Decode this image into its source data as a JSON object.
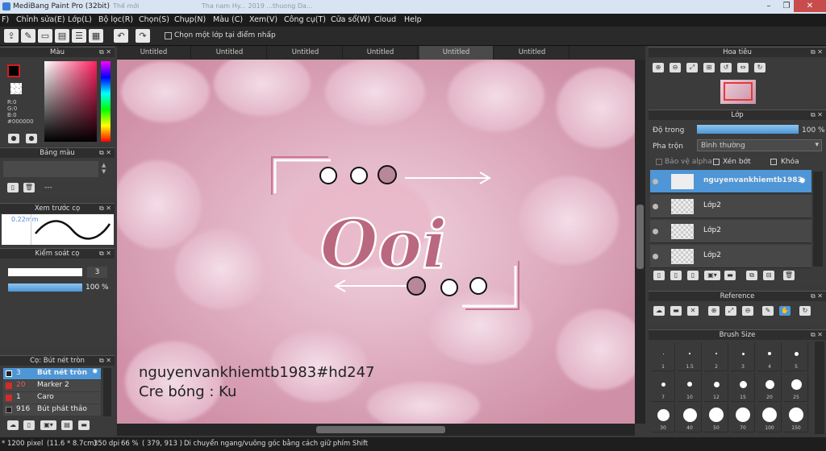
{
  "window": {
    "title": "MediBang Paint Pro (32bit)",
    "ghost_tab_1": "Thế mới",
    "ghost_tab_2": "Tha nam Hy... 2019 ...thuong Da..."
  },
  "menu": [
    "F)",
    "Chỉnh sửa(E)",
    "Lớp(L)",
    "Bộ lọc(R)",
    "Chọn(S)",
    "Chụp(N)",
    "Màu (C)",
    "Xem(V)",
    "Công cụ(T)",
    "Cửa sổ(W)",
    "Cloud",
    "Help"
  ],
  "toolbar": {
    "select_layer_checkbox": "Chọn một lớp tại điểm nhấp"
  },
  "color_panel": {
    "title": "Màu",
    "r": "R:0",
    "g": "G:0",
    "b": "B:0",
    "hex": "#000000"
  },
  "palette_panel": {
    "title": "Bảng màu",
    "label": "---"
  },
  "brush_preview_panel": {
    "title": "Xem trước cọ",
    "size": "0.22mm"
  },
  "brush_control_panel": {
    "title": "Kiểm soát cọ",
    "size_value": "3",
    "opacity_value": "100 %",
    "opacity_fraction": 1.0
  },
  "brush_list_panel": {
    "title": "Cọ: Bút nét tròn",
    "items": [
      {
        "num": "3",
        "name": "Bút nét tròn",
        "color": "#222222",
        "selected": true
      },
      {
        "num": "20",
        "name": "Marker 2",
        "color": "#d42b2b",
        "selected": false
      },
      {
        "num": "1",
        "name": "Caro",
        "color": "#d42b2b",
        "selected": false
      },
      {
        "num": "916",
        "name": "Bút phát thảo",
        "color": "#222222",
        "selected": false
      }
    ]
  },
  "tabs": [
    "Untitled",
    "Untitled",
    "Untitled",
    "Untitled",
    "Untitled",
    "Untitled"
  ],
  "active_tab_index": 4,
  "canvas": {
    "watermark_line1": "nguyenvankhiemtb1983#hd247",
    "watermark_line2": "Cre bóng : Ku",
    "logo_text": "Ooi"
  },
  "navigator_panel": {
    "title": "Hoa tiêu"
  },
  "layer_panel": {
    "title": "Lớp",
    "opacity_label": "Độ trong",
    "opacity_value": "100 %",
    "opacity_fraction": 1.0,
    "blend_label": "Pha trộn",
    "blend_value": "Bình thường",
    "protect_alpha": "Bảo vệ alpha",
    "clip": "Xén bớt",
    "lock": "Khóa",
    "layers": [
      {
        "name": "nguyenvankhiemtb1983",
        "selected": true
      },
      {
        "name": "Lớp2",
        "selected": false
      },
      {
        "name": "Lớp2",
        "selected": false
      },
      {
        "name": "Lớp2",
        "selected": false
      }
    ]
  },
  "reference_panel": {
    "title": "Reference"
  },
  "brush_size_panel": {
    "title": "Brush Size",
    "sizes": [
      "1",
      "1.5",
      "2",
      "3",
      "4",
      "5",
      "7",
      "10",
      "12",
      "15",
      "20",
      "25",
      "30",
      "40",
      "50",
      "70",
      "100",
      "150"
    ]
  },
  "status": {
    "size": "* 1200 pixel",
    "dims": "(11.6 * 8.7cm)",
    "dpi": "350 dpi",
    "zoom": "66 %",
    "coords": "( 379, 913 )",
    "hint": "Di chuyển ngang/vuông góc bằng cách giữ phím Shift"
  }
}
